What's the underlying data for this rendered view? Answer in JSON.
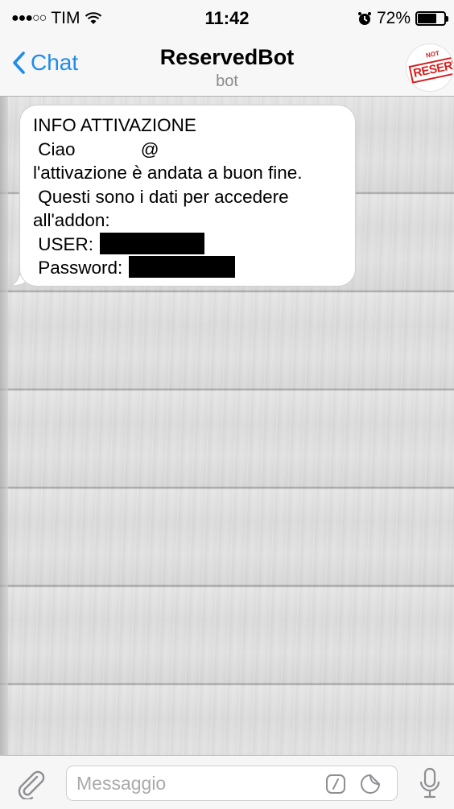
{
  "status_bar": {
    "signal": "●●●○○",
    "carrier": "TIM",
    "time": "11:42",
    "alarm_icon": "alarm-clock-icon",
    "battery_percent_label": "72%",
    "battery_level": 0.72
  },
  "nav": {
    "back_label": "Chat",
    "title": "ReservedBot",
    "subtitle": "bot",
    "avatar_text": "RESERVED",
    "avatar_small_text": "NOT"
  },
  "message": {
    "lines": [
      "INFO ATTIVAZIONE",
      " Ciao             @",
      "l'attivazione è andata a buon fine.",
      " Questi sono i dati per accedere",
      "all'addon:",
      " USER:",
      " Password:"
    ]
  },
  "input": {
    "placeholder": "Messaggio",
    "value": ""
  },
  "colors": {
    "accent": "#1f8ceb",
    "stamp": "#d42020"
  }
}
